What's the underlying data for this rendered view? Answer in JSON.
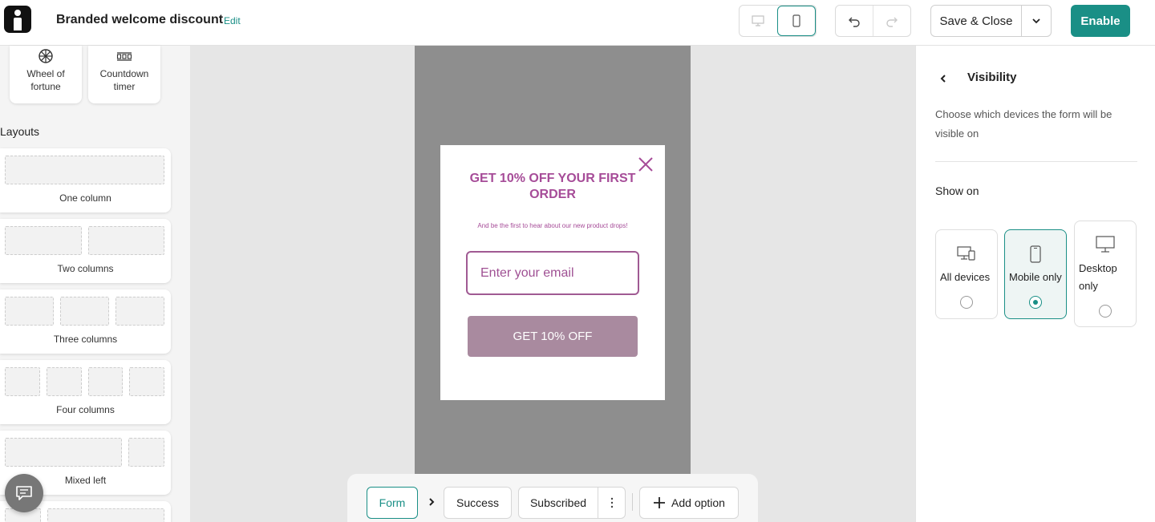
{
  "header": {
    "title": "Branded welcome discount",
    "edit_label": "Edit",
    "save_label": "Save & Close",
    "enable_label": "Enable",
    "accent_color": "#1a8f86"
  },
  "sidebar": {
    "tiles": [
      {
        "label": "Wheel of fortune",
        "icon": "wheel-icon"
      },
      {
        "label": "Countdown timer",
        "icon": "timer-icon"
      }
    ],
    "layouts_heading": "Layouts",
    "layouts": [
      {
        "label": "One column"
      },
      {
        "label": "Two columns"
      },
      {
        "label": "Three columns"
      },
      {
        "label": "Four columns"
      },
      {
        "label": "Mixed left"
      }
    ]
  },
  "popup": {
    "heading": "GET 10% OFF YOUR FIRST ORDER",
    "subheading": "And be the first to hear about our new product drops!",
    "email_placeholder": "Enter your email",
    "cta": "GET 10% OFF",
    "accent_color": "#a64c98",
    "cta_color": "#a98a9f"
  },
  "steps": {
    "form": "Form",
    "success": "Success",
    "subscribed": "Subscribed",
    "add_option": "Add option"
  },
  "visibility": {
    "title": "Visibility",
    "description": "Choose which devices the form will be visible on",
    "show_on": "Show on",
    "options": [
      {
        "label": "All devices",
        "selected": false
      },
      {
        "label": "Mobile only",
        "selected": true
      },
      {
        "label": "Desktop only",
        "selected": false
      }
    ]
  }
}
